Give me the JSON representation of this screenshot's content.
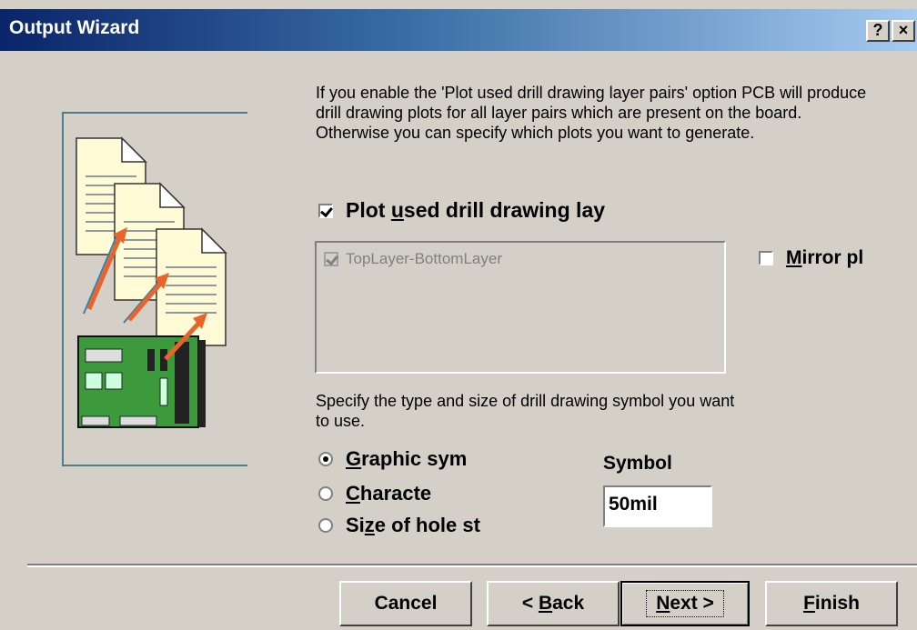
{
  "window": {
    "title": "Output Wizard",
    "help_button": "?",
    "close_button": "×"
  },
  "info_text": "If you enable the 'Plot used drill drawing layer pairs' option PCB will produce drill drawing plots for all layer pairs which are present on the board. Otherwise you can specify which plots you want to generate.",
  "plot_used": {
    "checked": true,
    "label_pre": "Plot ",
    "label_accel": "u",
    "label_post": "sed drill drawing lay"
  },
  "layer_list": {
    "items": [
      {
        "label": "TopLayer-BottomLayer",
        "checked": true,
        "enabled": false
      }
    ]
  },
  "mirror": {
    "checked": false,
    "label_accel": "M",
    "label_post": "irror pl"
  },
  "spec_text": "Specify the type and size of drill drawing symbol you want to use.",
  "symbol_type": {
    "options": [
      {
        "accel": "G",
        "rest": "raphic sym",
        "selected": true
      },
      {
        "accel": "C",
        "rest": "haracte",
        "selected": false
      },
      {
        "pre": "Si",
        "accel": "z",
        "rest": "e of hole st",
        "selected": false
      }
    ]
  },
  "symbol_size": {
    "label": "Symbol",
    "value": "50mil"
  },
  "buttons": {
    "cancel": "Cancel",
    "back_prefix": "< ",
    "back_accel": "B",
    "back_rest": "ack",
    "next_accel": "N",
    "next_rest": "ext >",
    "finish_accel": "F",
    "finish_rest": "inish"
  },
  "colors": {
    "title_gradient_start": "#0a246a",
    "title_gradient_end": "#a6caf0",
    "face": "#d4d0c8",
    "board_green": "#3c9a3c",
    "arrow_orange": "#e8642a"
  }
}
